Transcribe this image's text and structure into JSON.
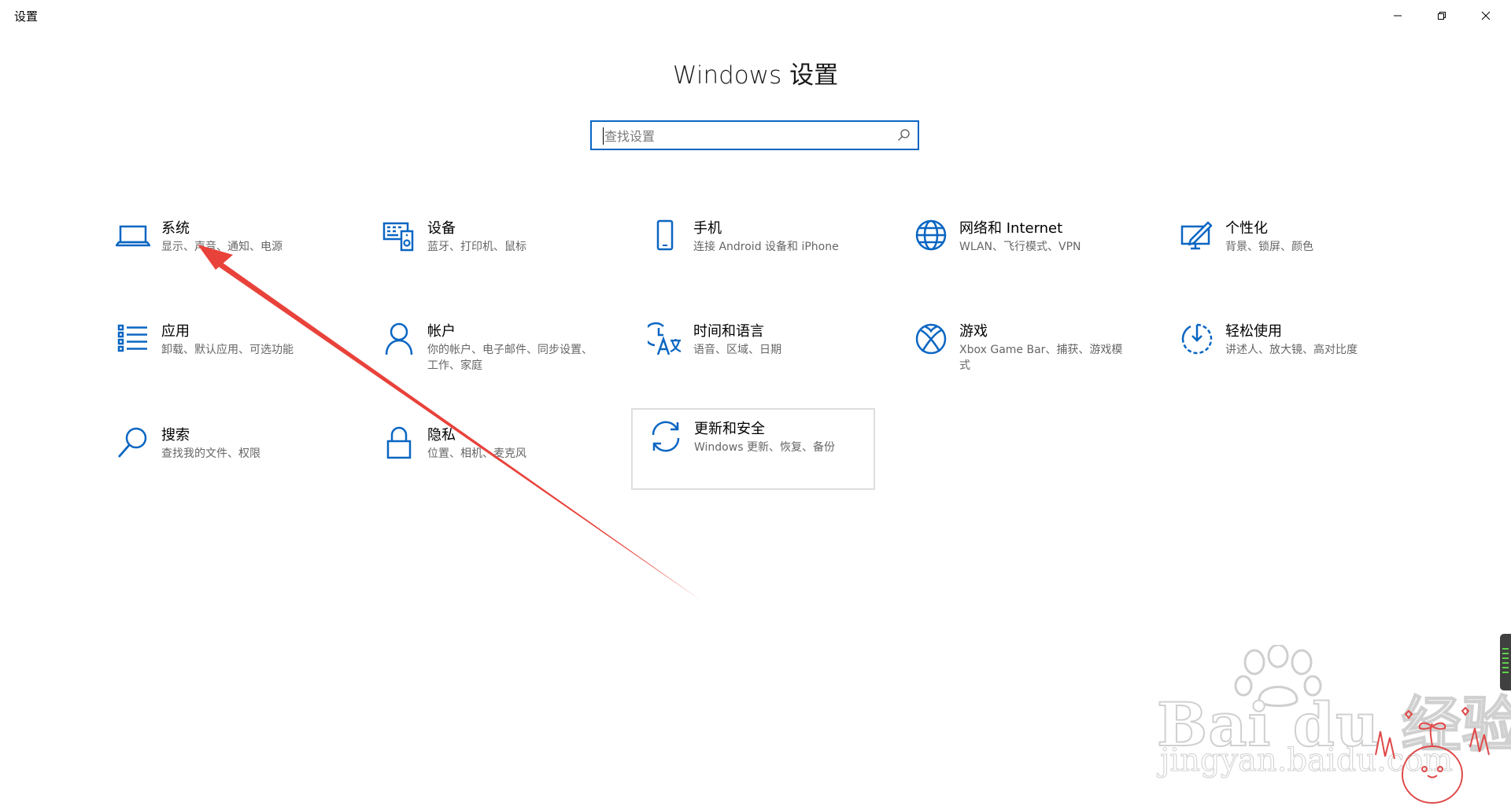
{
  "window": {
    "title": "设置",
    "controls": [
      "minimize-icon",
      "restore-icon",
      "close-icon"
    ]
  },
  "heading": "Windows 设置",
  "search": {
    "placeholder": "查找设置",
    "value": "",
    "icon": "search-icon"
  },
  "tiles": [
    {
      "id": "system",
      "icon": "laptop-icon",
      "title": "系统",
      "subtitle": "显示、声音、通知、电源"
    },
    {
      "id": "devices",
      "icon": "devices-icon",
      "title": "设备",
      "subtitle": "蓝牙、打印机、鼠标"
    },
    {
      "id": "phone",
      "icon": "phone-icon",
      "title": "手机",
      "subtitle": "连接 Android 设备和 iPhone"
    },
    {
      "id": "network",
      "icon": "globe-icon",
      "title": "网络和 Internet",
      "subtitle": "WLAN、飞行模式、VPN"
    },
    {
      "id": "personalization",
      "icon": "personalization-icon",
      "title": "个性化",
      "subtitle": "背景、锁屏、颜色"
    },
    {
      "id": "apps",
      "icon": "apps-list-icon",
      "title": "应用",
      "subtitle": "卸载、默认应用、可选功能"
    },
    {
      "id": "accounts",
      "icon": "person-icon",
      "title": "帐户",
      "subtitle": "你的帐户、电子邮件、同步设置、工作、家庭"
    },
    {
      "id": "time-language",
      "icon": "time-language-icon",
      "title": "时间和语言",
      "subtitle": "语音、区域、日期"
    },
    {
      "id": "gaming",
      "icon": "xbox-icon",
      "title": "游戏",
      "subtitle": "Xbox Game Bar、捕获、游戏模式"
    },
    {
      "id": "ease-of-access",
      "icon": "ease-of-access-icon",
      "title": "轻松使用",
      "subtitle": "讲述人、放大镜、高对比度"
    },
    {
      "id": "search",
      "icon": "magnifier-icon",
      "title": "搜索",
      "subtitle": "查找我的文件、权限"
    },
    {
      "id": "privacy",
      "icon": "lock-icon",
      "title": "隐私",
      "subtitle": "位置、相机、麦克风"
    },
    {
      "id": "update-security",
      "icon": "sync-icon",
      "title": "更新和安全",
      "subtitle": "Windows 更新、恢复、备份"
    }
  ],
  "annotation": {
    "color": "#e8423a"
  },
  "watermark": {
    "brand": "Bai du 经验",
    "url": "jingyan.baidu.com"
  },
  "accent": "#0a66c2"
}
